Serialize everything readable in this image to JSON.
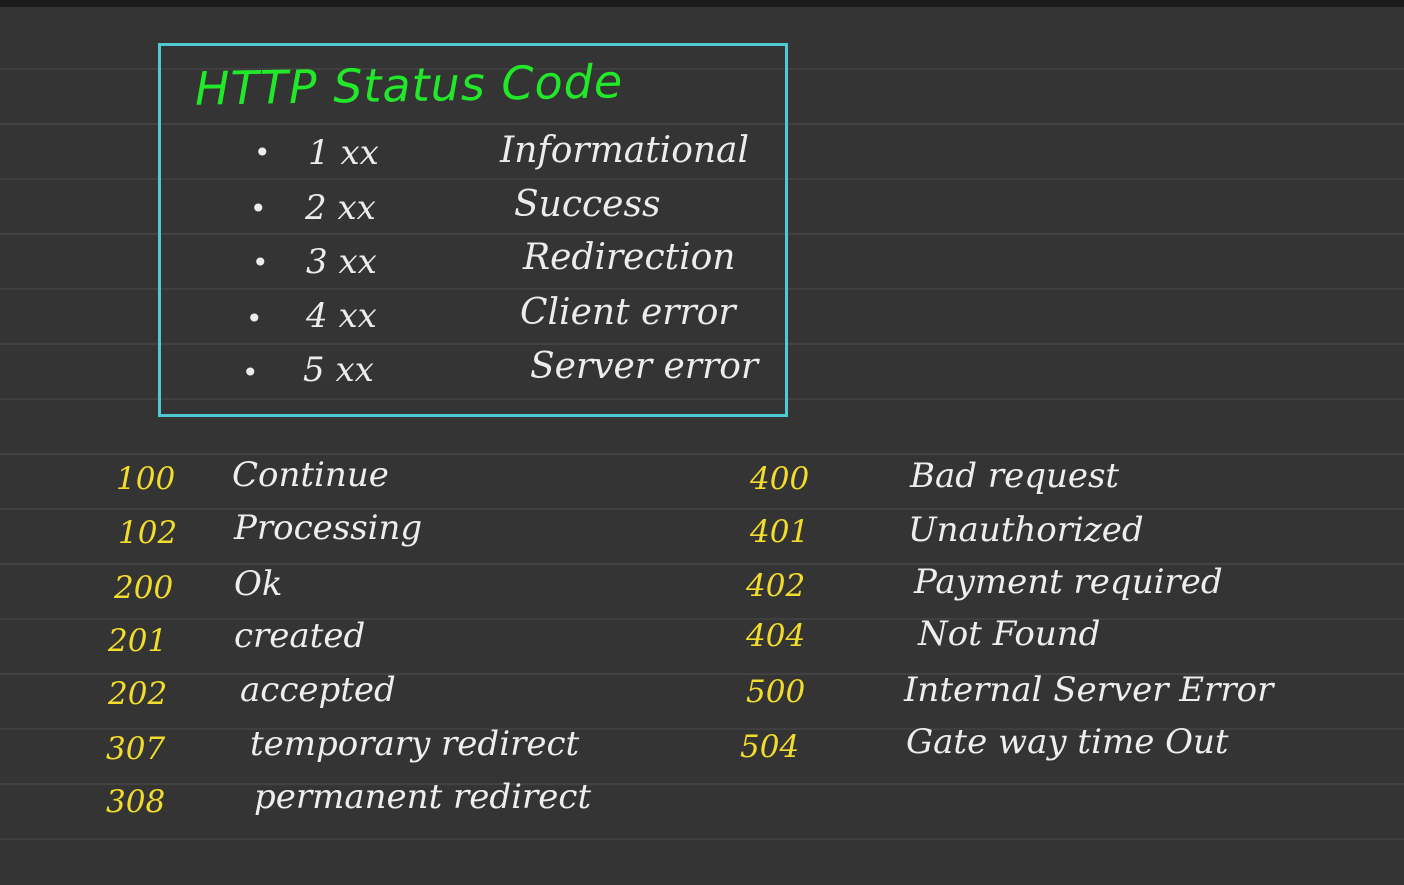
{
  "title": "HTTP Status Code",
  "classes": [
    {
      "code": "1 xx",
      "name": "Informational"
    },
    {
      "code": "2 xx",
      "name": "Success"
    },
    {
      "code": "3 xx",
      "name": "Redirection"
    },
    {
      "code": "4 xx",
      "name": "Client error"
    },
    {
      "code": "5 xx",
      "name": "Server error"
    }
  ],
  "left_codes": [
    {
      "code": "100",
      "desc": "Continue"
    },
    {
      "code": "102",
      "desc": "Processing"
    },
    {
      "code": "200",
      "desc": "Ok"
    },
    {
      "code": "201",
      "desc": "created"
    },
    {
      "code": "202",
      "desc": "accepted"
    },
    {
      "code": "307",
      "desc": "temporary redirect"
    },
    {
      "code": "308",
      "desc": "permanent redirect"
    }
  ],
  "right_codes": [
    {
      "code": "400",
      "desc": "Bad request"
    },
    {
      "code": "401",
      "desc": "Unauthorized"
    },
    {
      "code": "402",
      "desc": "Payment required"
    },
    {
      "code": "404",
      "desc": "Not Found"
    },
    {
      "code": "500",
      "desc": "Internal Server Error"
    },
    {
      "code": "504",
      "desc": "Gate way time Out"
    }
  ],
  "colors": {
    "background": "#343434",
    "box_border": "#4fc9d2",
    "title": "#22e82a",
    "code": "#f2dc2c",
    "text": "#ececec"
  }
}
